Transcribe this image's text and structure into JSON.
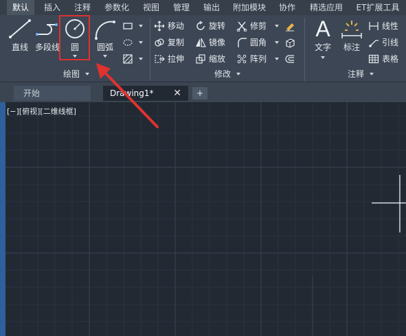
{
  "menubar": {
    "tabs": [
      "默认",
      "插入",
      "注释",
      "参数化",
      "视图",
      "管理",
      "输出",
      "附加模块",
      "协作",
      "精选应用",
      "ET扩展工具"
    ],
    "active_tab": "默认"
  },
  "ribbon": {
    "draw": {
      "title": "绘图",
      "line": "直线",
      "polyline": "多段线",
      "circle": "圆",
      "arc": "圆弧"
    },
    "modify": {
      "title": "修改",
      "move": "移动",
      "rotate": "旋转",
      "trim": "修剪",
      "copy": "复制",
      "mirror": "镜像",
      "fillet": "圆角",
      "stretch": "拉伸",
      "scale": "缩放",
      "array": "阵列"
    },
    "annotation": {
      "title": "注释",
      "text": "文字",
      "dimension": "标注",
      "linear": "线性",
      "leader": "引线",
      "table": "表格"
    }
  },
  "doc_tabs": {
    "start": "开始",
    "drawing": "Drawing1*",
    "new_tab": "+"
  },
  "viewport": {
    "label": "[−][俯视][二维线框]"
  },
  "colors": {
    "accent_red": "#e0322f",
    "canvas_bg": "#222933",
    "ribbon_bg": "#3c4654"
  }
}
